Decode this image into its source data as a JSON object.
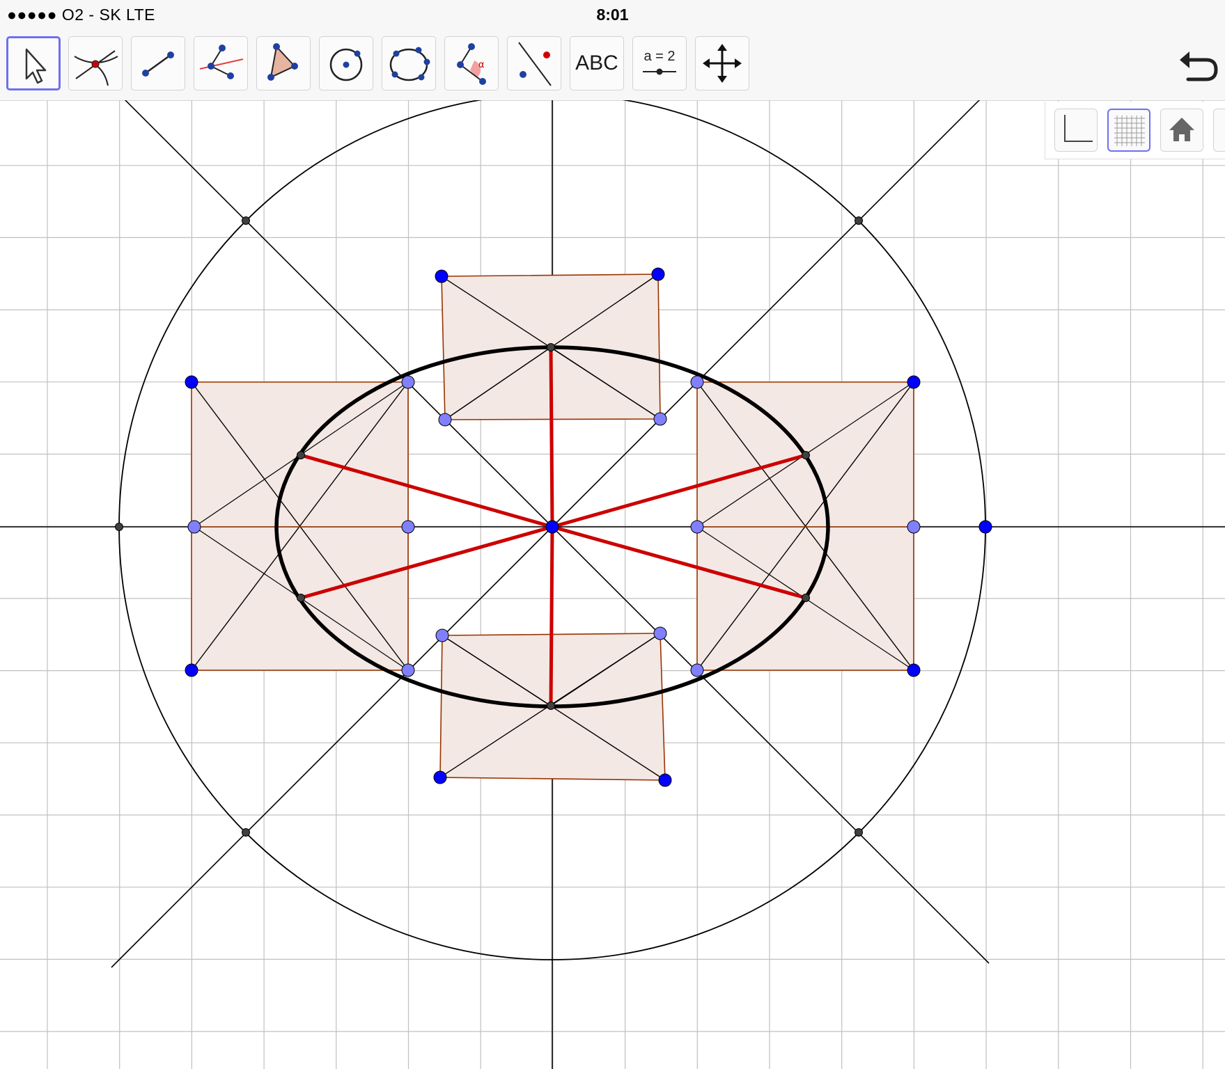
{
  "status_bar": {
    "carrier": "●●●●● O2 - SK   LTE",
    "time": "8:01"
  },
  "toolbar": {
    "tools": [
      {
        "icon": "move-arrow-icon"
      },
      {
        "icon": "intersect-point-icon"
      },
      {
        "icon": "segment-icon"
      },
      {
        "icon": "perpendicular-line-icon"
      },
      {
        "icon": "polygon-icon"
      },
      {
        "icon": "circle-center-point-icon"
      },
      {
        "icon": "conic-five-points-icon"
      },
      {
        "icon": "angle-icon"
      },
      {
        "icon": "reflect-point-icon"
      },
      {
        "icon": "text-tool-icon",
        "label": "ABC"
      },
      {
        "icon": "slider-icon",
        "label": "a = 2"
      },
      {
        "icon": "move-graphics-icon"
      }
    ],
    "undo_icon": "undo-icon"
  },
  "style_bar": {
    "buttons": [
      {
        "icon": "axes-toggle-icon",
        "active": false
      },
      {
        "icon": "grid-toggle-icon",
        "active": true
      },
      {
        "icon": "home-icon",
        "active": false
      },
      {
        "icon": "more-icon",
        "active": false
      }
    ]
  },
  "colors": {
    "accent": "#6f6ff0",
    "point_blue": "#0000ff",
    "point_light": "#8080ff",
    "point_dark": "#404040",
    "segment_red": "#cc0000",
    "polygon_stroke": "#993300",
    "polygon_fill": "#f3e8e4",
    "grid": "#c0c0c0",
    "ellipse": "#000000"
  }
}
